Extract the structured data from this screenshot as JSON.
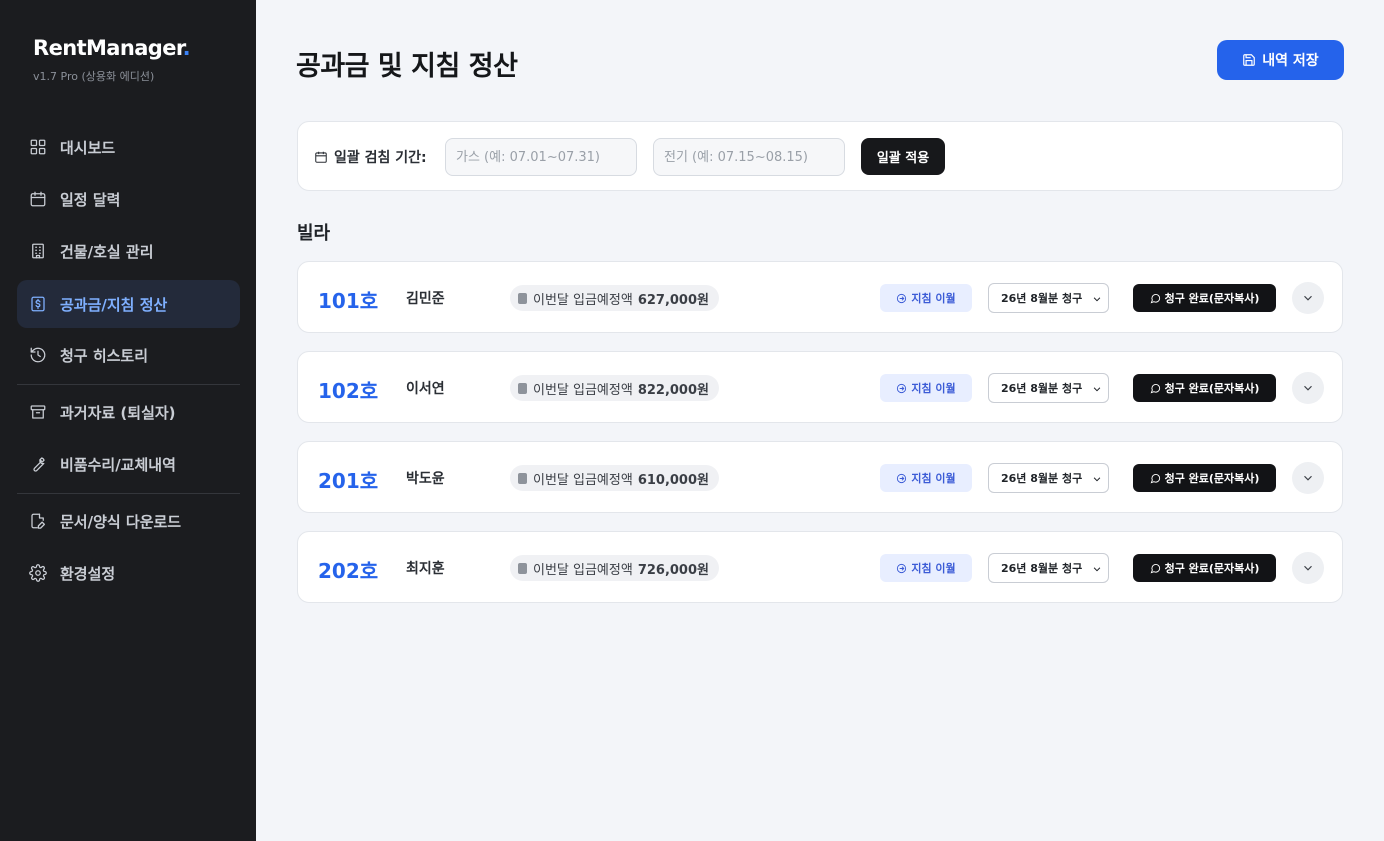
{
  "sidebar": {
    "brand": "RentManager",
    "brand_dot": ".",
    "version": "v1.7 Pro (상용화 에디션)",
    "items": [
      {
        "label": "대시보드",
        "icon": "grid-icon"
      },
      {
        "label": "일정 달력",
        "icon": "calendar-icon"
      },
      {
        "label": "건물/호실 관리",
        "icon": "building-icon"
      },
      {
        "label": "공과금/지침 정산",
        "icon": "receipt-icon",
        "active": true
      },
      {
        "label": "청구 히스토리",
        "icon": "history-icon"
      },
      {
        "label": "과거자료 (퇴실자)",
        "icon": "archive-icon"
      },
      {
        "label": "비품수리/교체내역",
        "icon": "wrench-icon"
      },
      {
        "label": "문서/양식 다운로드",
        "icon": "document-edit-icon"
      },
      {
        "label": "환경설정",
        "icon": "gear-icon"
      }
    ]
  },
  "header": {
    "title": "공과금 및 지침 정산",
    "save_label": "내역 저장"
  },
  "filter": {
    "label": "일괄 검침 기간:",
    "gas_placeholder": "가스 (예: 07.01~07.31)",
    "electric_placeholder": "전기 (예: 07.15~08.15)",
    "apply_label": "일괄 적용"
  },
  "section": {
    "title": "빌라"
  },
  "units": [
    {
      "unit": "101호",
      "tenant": "김민준",
      "deposit_label": "이번달 입금예정액",
      "deposit_amount": "627,000원",
      "carry_label": "지침 이월",
      "month_select": "26년 8월분 청구",
      "billed_label": "청구 완료(문자복사)"
    },
    {
      "unit": "102호",
      "tenant": "이서연",
      "deposit_label": "이번달 입금예정액",
      "deposit_amount": "822,000원",
      "carry_label": "지침 이월",
      "month_select": "26년 8월분 청구",
      "billed_label": "청구 완료(문자복사)"
    },
    {
      "unit": "201호",
      "tenant": "박도윤",
      "deposit_label": "이번달 입금예정액",
      "deposit_amount": "610,000원",
      "carry_label": "지침 이월",
      "month_select": "26년 8월분 청구",
      "billed_label": "청구 완료(문자복사)"
    },
    {
      "unit": "202호",
      "tenant": "최지훈",
      "deposit_label": "이번달 입금예정액",
      "deposit_amount": "726,000원",
      "carry_label": "지침 이월",
      "month_select": "26년 8월분 청구",
      "billed_label": "청구 완료(문자복사)"
    }
  ],
  "colors": {
    "accent": "#2563eb",
    "sidebar_bg": "#1b1c1f",
    "active_text": "#7fb0ff"
  }
}
